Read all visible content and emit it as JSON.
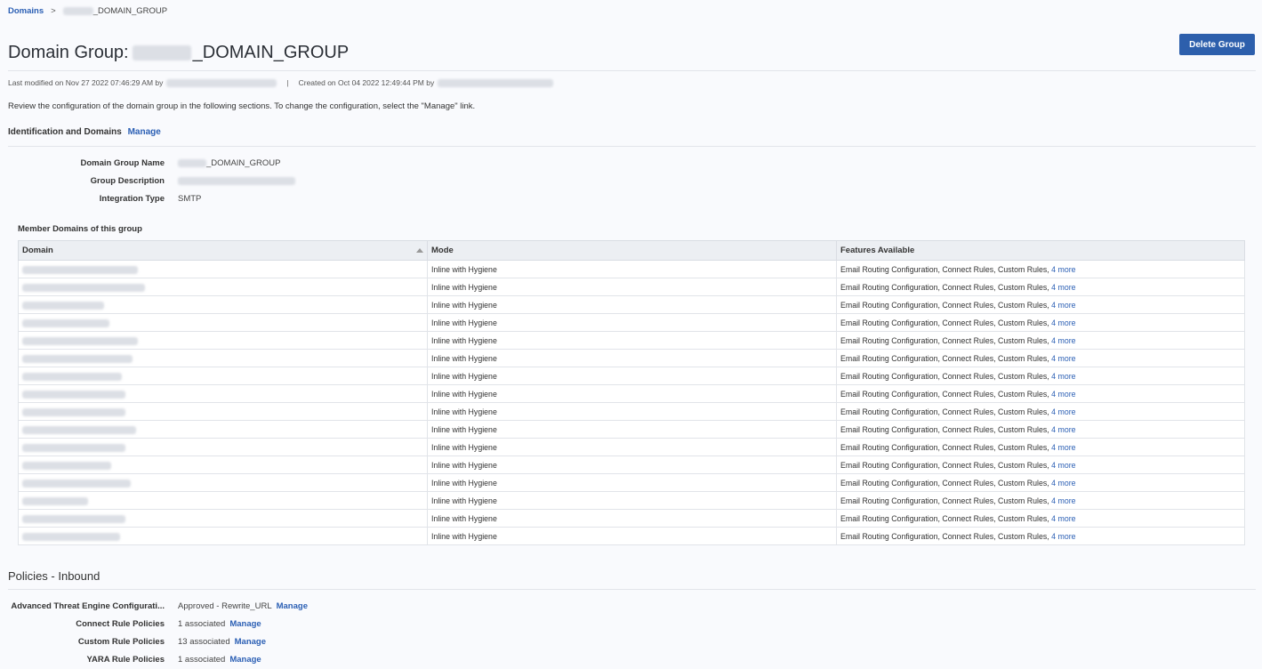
{
  "breadcrumb": {
    "root": "Domains",
    "separator": ">",
    "current_suffix": "_DOMAIN_GROUP"
  },
  "header": {
    "title_prefix": "Domain Group:",
    "title_suffix": "_DOMAIN_GROUP",
    "delete_button": "Delete Group"
  },
  "meta": {
    "modified": "Last modified on Nov 27 2022 07:46:29 AM by",
    "separator": "|",
    "created": "Created on Oct 04 2022 12:49:44 PM by"
  },
  "intro": "Review the configuration of the domain group in the following sections. To change the configuration, select the \"Manage\" link.",
  "identification": {
    "heading": "Identification and Domains",
    "manage": "Manage",
    "fields": {
      "name_label": "Domain Group Name",
      "name_value_suffix": "_DOMAIN_GROUP",
      "description_label": "Group Description",
      "integration_label": "Integration Type",
      "integration_value": "SMTP"
    }
  },
  "members": {
    "title": "Member Domains of this group",
    "columns": [
      "Domain",
      "Mode",
      "Features Available"
    ],
    "rows": [
      {
        "mode": "Inline with Hygiene",
        "features": "Email Routing Configuration, Connect Rules, Custom Rules,",
        "more": "4 more"
      },
      {
        "mode": "Inline with Hygiene",
        "features": "Email Routing Configuration, Connect Rules, Custom Rules,",
        "more": "4 more"
      },
      {
        "mode": "Inline with Hygiene",
        "features": "Email Routing Configuration, Connect Rules, Custom Rules,",
        "more": "4 more"
      },
      {
        "mode": "Inline with Hygiene",
        "features": "Email Routing Configuration, Connect Rules, Custom Rules,",
        "more": "4 more"
      },
      {
        "mode": "Inline with Hygiene",
        "features": "Email Routing Configuration, Connect Rules, Custom Rules,",
        "more": "4 more"
      },
      {
        "mode": "Inline with Hygiene",
        "features": "Email Routing Configuration, Connect Rules, Custom Rules,",
        "more": "4 more"
      },
      {
        "mode": "Inline with Hygiene",
        "features": "Email Routing Configuration, Connect Rules, Custom Rules,",
        "more": "4 more"
      },
      {
        "mode": "Inline with Hygiene",
        "features": "Email Routing Configuration, Connect Rules, Custom Rules,",
        "more": "4 more"
      },
      {
        "mode": "Inline with Hygiene",
        "features": "Email Routing Configuration, Connect Rules, Custom Rules,",
        "more": "4 more"
      },
      {
        "mode": "Inline with Hygiene",
        "features": "Email Routing Configuration, Connect Rules, Custom Rules,",
        "more": "4 more"
      },
      {
        "mode": "Inline with Hygiene",
        "features": "Email Routing Configuration, Connect Rules, Custom Rules,",
        "more": "4 more"
      },
      {
        "mode": "Inline with Hygiene",
        "features": "Email Routing Configuration, Connect Rules, Custom Rules,",
        "more": "4 more"
      },
      {
        "mode": "Inline with Hygiene",
        "features": "Email Routing Configuration, Connect Rules, Custom Rules,",
        "more": "4 more"
      },
      {
        "mode": "Inline with Hygiene",
        "features": "Email Routing Configuration, Connect Rules, Custom Rules,",
        "more": "4 more"
      },
      {
        "mode": "Inline with Hygiene",
        "features": "Email Routing Configuration, Connect Rules, Custom Rules,",
        "more": "4 more"
      },
      {
        "mode": "Inline with Hygiene",
        "features": "Email Routing Configuration, Connect Rules, Custom Rules,",
        "more": "4 more"
      }
    ]
  },
  "policies": {
    "title": "Policies - Inbound",
    "items": [
      {
        "label": "Advanced Threat Engine Configurati...",
        "value": "Approved - Rewrite_URL",
        "manage": "Manage"
      },
      {
        "label": "Connect Rule Policies",
        "value": "1 associated",
        "manage": "Manage"
      },
      {
        "label": "Custom Rule Policies",
        "value": "13 associated",
        "manage": "Manage"
      },
      {
        "label": "YARA Rule Policies",
        "value": "1 associated",
        "manage": "Manage"
      }
    ]
  }
}
